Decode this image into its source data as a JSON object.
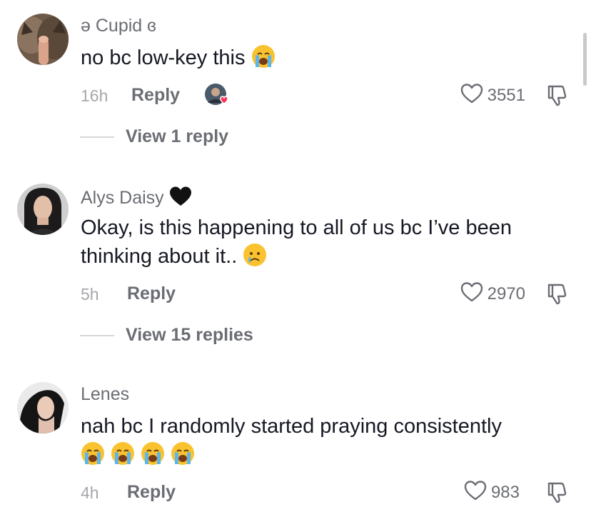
{
  "comments": [
    {
      "username_prefix": "ə",
      "username": "Cupid",
      "username_suffix": "ɞ",
      "text": "no bc low-key this",
      "time": "16h",
      "reply_label": "Reply",
      "likes": "3551",
      "view_replies": "View 1 reply",
      "emoji": "loudly-crying-face",
      "liked_by_creator": true
    },
    {
      "username": "Alys Daisy",
      "username_deco": "black-heart",
      "text": "Okay, is this happening to all of us bc I’ve been thinking about it..",
      "time": "5h",
      "reply_label": "Reply",
      "likes": "2970",
      "view_replies": "View 15 replies",
      "emoji": "crying-face"
    },
    {
      "username": "Lenes",
      "text": "nah bc I randomly started praying consistently",
      "time": "4h",
      "reply_label": "Reply",
      "likes": "983",
      "emoji": "loudly-crying-face",
      "emoji_count": 4
    }
  ],
  "colors": {
    "text": "#161823",
    "muted": "#6b6d74",
    "time": "#a6a7ab",
    "like_badge": "#fe2c55"
  }
}
